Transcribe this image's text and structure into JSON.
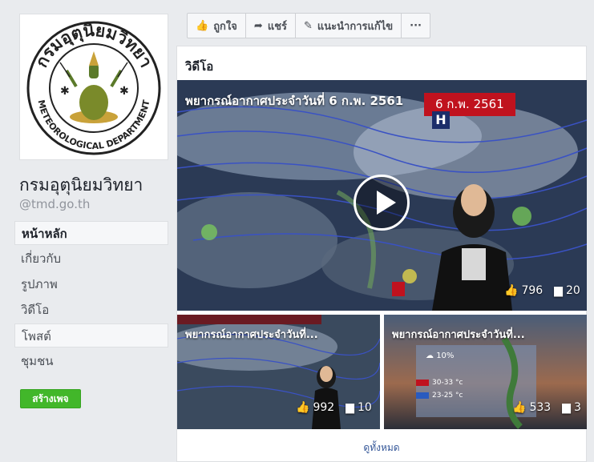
{
  "page": {
    "name": "กรมอุตุนิยมวิทยา",
    "handle": "@tmd.go.th",
    "logo": {
      "top_text": "กรมอุตุนิยมวิทยา",
      "bottom_text": "METEOROLOGICAL DEPARTMENT"
    }
  },
  "nav": {
    "items": [
      {
        "label": "หน้าหลัก"
      },
      {
        "label": "เกี่ยวกับ"
      },
      {
        "label": "รูปภาพ"
      },
      {
        "label": "วิดีโอ"
      },
      {
        "label": "โพสต์"
      },
      {
        "label": "ชุมชน"
      }
    ],
    "create_page": "สร้างเพจ"
  },
  "actions": {
    "like": "ถูกใจ",
    "share": "แชร์",
    "suggest_edit": "แนะนำการแก้ไข",
    "more": "···"
  },
  "videos": {
    "section_title": "วิดีโอ",
    "main": {
      "title": "พยากรณ์อากาศประจำวันที่ 6 ก.พ. 2561",
      "date_badge": "6 ก.พ. 2561",
      "pressure_marker": "H",
      "likes": "796",
      "comments": "20"
    },
    "small": [
      {
        "title": "พยากรณ์อากาศประจำวันที่...",
        "likes": "992",
        "comments": "10"
      },
      {
        "title": "พยากรณ์อากาศประจำวันที่...",
        "likes": "533",
        "comments": "3",
        "overlay": {
          "rain": "10%",
          "temp_max": "30-33 °c",
          "temp_min": "23-25 °c"
        }
      }
    ],
    "see_all": "ดูทั้งหมด"
  },
  "colors": {
    "background": "#e9ebee",
    "link": "#365899",
    "create_button": "#42b72a",
    "date_badge": "#c0121e"
  }
}
